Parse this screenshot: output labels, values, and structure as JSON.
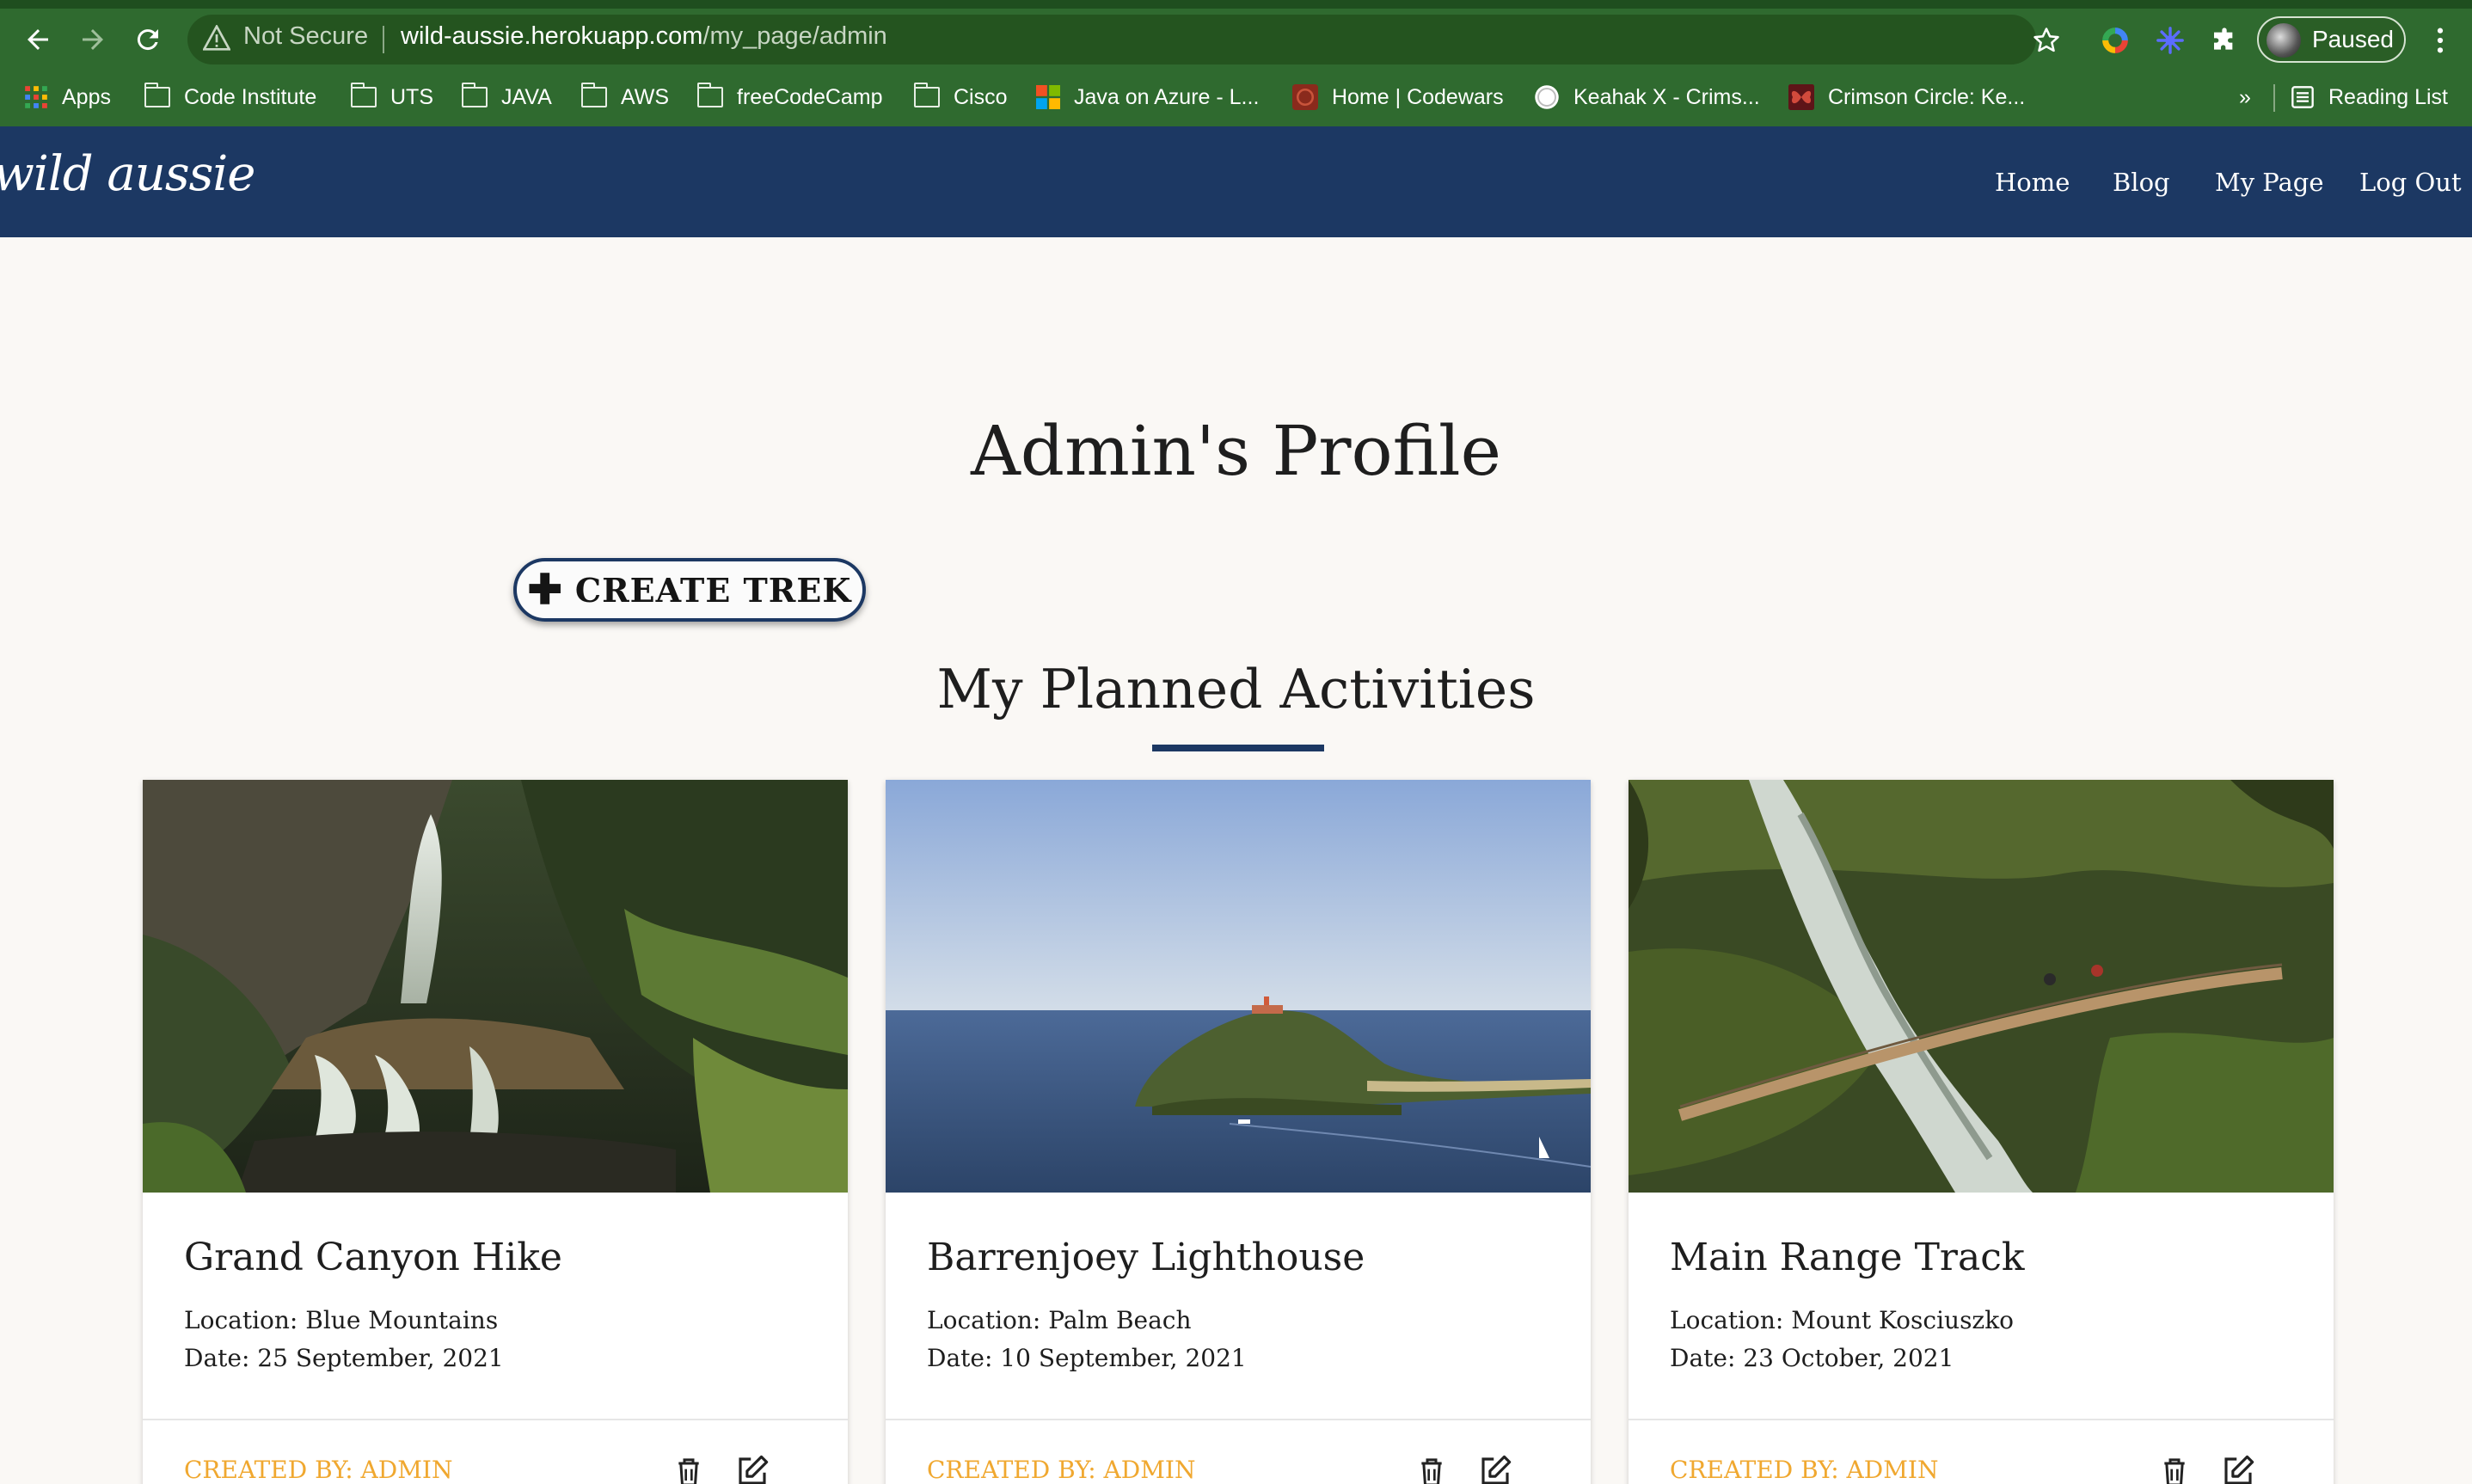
{
  "browser": {
    "not_secure": "Not Secure",
    "url_host": "wild-aussie.herokuapp.com",
    "url_path": "/my_page/admin",
    "profile_status": "Paused",
    "bookmarks": [
      {
        "label": "Apps",
        "icon": "apps-grid-icon"
      },
      {
        "label": "Code Institute",
        "icon": "folder-icon"
      },
      {
        "label": "UTS",
        "icon": "folder-icon"
      },
      {
        "label": "JAVA",
        "icon": "folder-icon"
      },
      {
        "label": "AWS",
        "icon": "folder-icon"
      },
      {
        "label": "freeCodeCamp",
        "icon": "folder-icon"
      },
      {
        "label": "Cisco",
        "icon": "folder-icon"
      },
      {
        "label": "Java on Azure - L...",
        "icon": "microsoft-icon"
      },
      {
        "label": "Home | Codewars",
        "icon": "codewars-icon"
      },
      {
        "label": "Keahak X - Crims...",
        "icon": "circle-icon"
      },
      {
        "label": "Crimson Circle: Ke...",
        "icon": "butterfly-icon"
      }
    ],
    "overflow_chevron": "»",
    "reading_list": "Reading List"
  },
  "site": {
    "brand": "wild aussie",
    "nav": [
      "Home",
      "Blog",
      "My Page",
      "Log Out"
    ],
    "colors": {
      "navbar": "#1c3863",
      "accent": "#f0a830",
      "background": "#faf8f5"
    }
  },
  "page": {
    "title": "Admin's Profile",
    "create_button": "CREATE TREK",
    "section_title": "My Planned Activities"
  },
  "cards": [
    {
      "title": "Grand Canyon Hike",
      "location": "Location: Blue Mountains",
      "date": "Date: 25 September, 2021",
      "created_by": "CREATED BY: ADMIN",
      "image": "waterfall-forest-photo"
    },
    {
      "title": "Barrenjoey Lighthouse",
      "location": "Location: Palm Beach",
      "date": "Date: 10 September, 2021",
      "created_by": "CREATED BY: ADMIN",
      "image": "headland-ocean-photo"
    },
    {
      "title": "Main Range Track",
      "location": "Location: Mount Kosciuszko",
      "date": "Date: 23 October, 2021",
      "created_by": "CREATED BY: ADMIN",
      "image": "river-bridge-photo"
    }
  ]
}
